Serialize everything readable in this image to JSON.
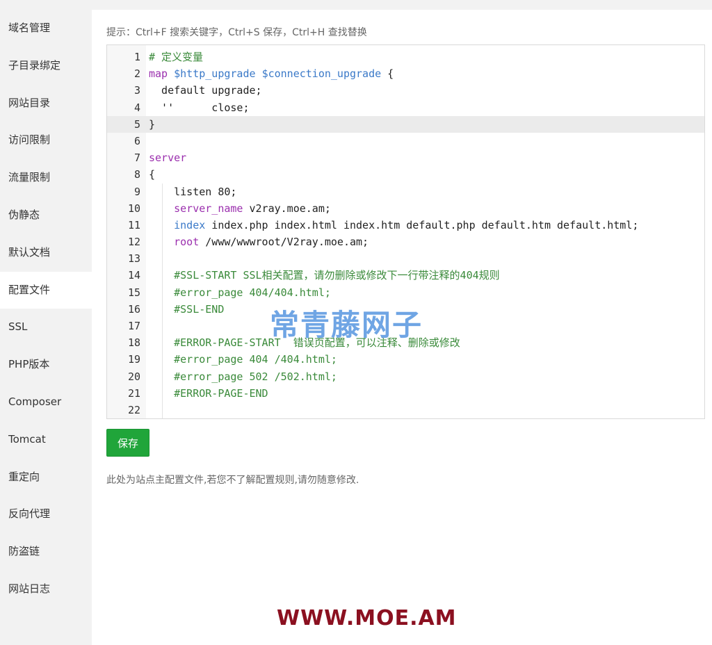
{
  "sidebar": {
    "items": [
      {
        "label": "域名管理",
        "active": false
      },
      {
        "label": "子目录绑定",
        "active": false
      },
      {
        "label": "网站目录",
        "active": false
      },
      {
        "label": "访问限制",
        "active": false
      },
      {
        "label": "流量限制",
        "active": false
      },
      {
        "label": "伪静态",
        "active": false
      },
      {
        "label": "默认文档",
        "active": false
      },
      {
        "label": "配置文件",
        "active": true
      },
      {
        "label": "SSL",
        "active": false
      },
      {
        "label": "PHP版本",
        "active": false
      },
      {
        "label": "Composer",
        "active": false
      },
      {
        "label": "Tomcat",
        "active": false
      },
      {
        "label": "重定向",
        "active": false
      },
      {
        "label": "反向代理",
        "active": false
      },
      {
        "label": "防盗链",
        "active": false
      },
      {
        "label": "网站日志",
        "active": false
      }
    ]
  },
  "main": {
    "tip": "提示：Ctrl+F 搜索关键字，Ctrl+S 保存，Ctrl+H 查找替换",
    "save_label": "保存",
    "note": "此处为站点主配置文件,若您不了解配置规则,请勿随意修改."
  },
  "editor": {
    "active_line": 5,
    "lines": [
      {
        "num": "1",
        "segments": [
          {
            "text": "# 定义变量",
            "type": "comment"
          }
        ]
      },
      {
        "num": "2",
        "segments": [
          {
            "text": "map",
            "type": "keyword"
          },
          {
            "text": " ",
            "type": "plain"
          },
          {
            "text": "$http_upgrade",
            "type": "var"
          },
          {
            "text": " ",
            "type": "plain"
          },
          {
            "text": "$connection_upgrade",
            "type": "var"
          },
          {
            "text": " {",
            "type": "plain"
          }
        ]
      },
      {
        "num": "3",
        "segments": [
          {
            "text": "  default upgrade;",
            "type": "plain"
          }
        ]
      },
      {
        "num": "4",
        "segments": [
          {
            "text": "  ''      close;",
            "type": "plain"
          }
        ]
      },
      {
        "num": "5",
        "segments": [
          {
            "text": "}",
            "type": "plain"
          }
        ]
      },
      {
        "num": "6",
        "segments": []
      },
      {
        "num": "7",
        "segments": [
          {
            "text": "server",
            "type": "keyword"
          }
        ]
      },
      {
        "num": "8",
        "segments": [
          {
            "text": "{",
            "type": "plain"
          }
        ]
      },
      {
        "num": "9",
        "segments": [
          {
            "text": "    listen 80;",
            "type": "plain"
          }
        ]
      },
      {
        "num": "10",
        "segments": [
          {
            "text": "    ",
            "type": "plain"
          },
          {
            "text": "server_name",
            "type": "prop"
          },
          {
            "text": " v2ray.moe.am;",
            "type": "plain"
          }
        ]
      },
      {
        "num": "11",
        "segments": [
          {
            "text": "    ",
            "type": "plain"
          },
          {
            "text": "index",
            "type": "var"
          },
          {
            "text": " index.php index.html index.htm default.php default.htm default.html;",
            "type": "plain"
          }
        ]
      },
      {
        "num": "12",
        "segments": [
          {
            "text": "    ",
            "type": "plain"
          },
          {
            "text": "root",
            "type": "prop"
          },
          {
            "text": " /www/wwwroot/V2ray.moe.am;",
            "type": "plain"
          }
        ]
      },
      {
        "num": "13",
        "segments": []
      },
      {
        "num": "14",
        "segments": [
          {
            "text": "    #SSL-START SSL相关配置，请勿删除或修改下一行带注释的404规则",
            "type": "comment"
          }
        ]
      },
      {
        "num": "15",
        "segments": [
          {
            "text": "    #error_page 404/404.html;",
            "type": "comment"
          }
        ]
      },
      {
        "num": "16",
        "segments": [
          {
            "text": "    #SSL-END",
            "type": "comment"
          }
        ]
      },
      {
        "num": "17",
        "segments": []
      },
      {
        "num": "18",
        "segments": [
          {
            "text": "    #ERROR-PAGE-START  错误页配置，可以注释、删除或修改",
            "type": "comment"
          }
        ]
      },
      {
        "num": "19",
        "segments": [
          {
            "text": "    #error_page 404 /404.html;",
            "type": "comment"
          }
        ]
      },
      {
        "num": "20",
        "segments": [
          {
            "text": "    #error_page 502 /502.html;",
            "type": "comment"
          }
        ]
      },
      {
        "num": "21",
        "segments": [
          {
            "text": "    #ERROR-PAGE-END",
            "type": "comment"
          }
        ]
      },
      {
        "num": "22",
        "segments": []
      }
    ]
  },
  "watermarks": {
    "cn_text": "常青藤网子",
    "url_text": "WWW.MOE.AM"
  },
  "colors": {
    "sidebar_bg": "#f2f2f2",
    "save_button": "#20a53a",
    "comment": "#3a8a3a",
    "keyword": "#9b2fae",
    "variable": "#3a79c8",
    "watermark_url": "#8b1020"
  }
}
